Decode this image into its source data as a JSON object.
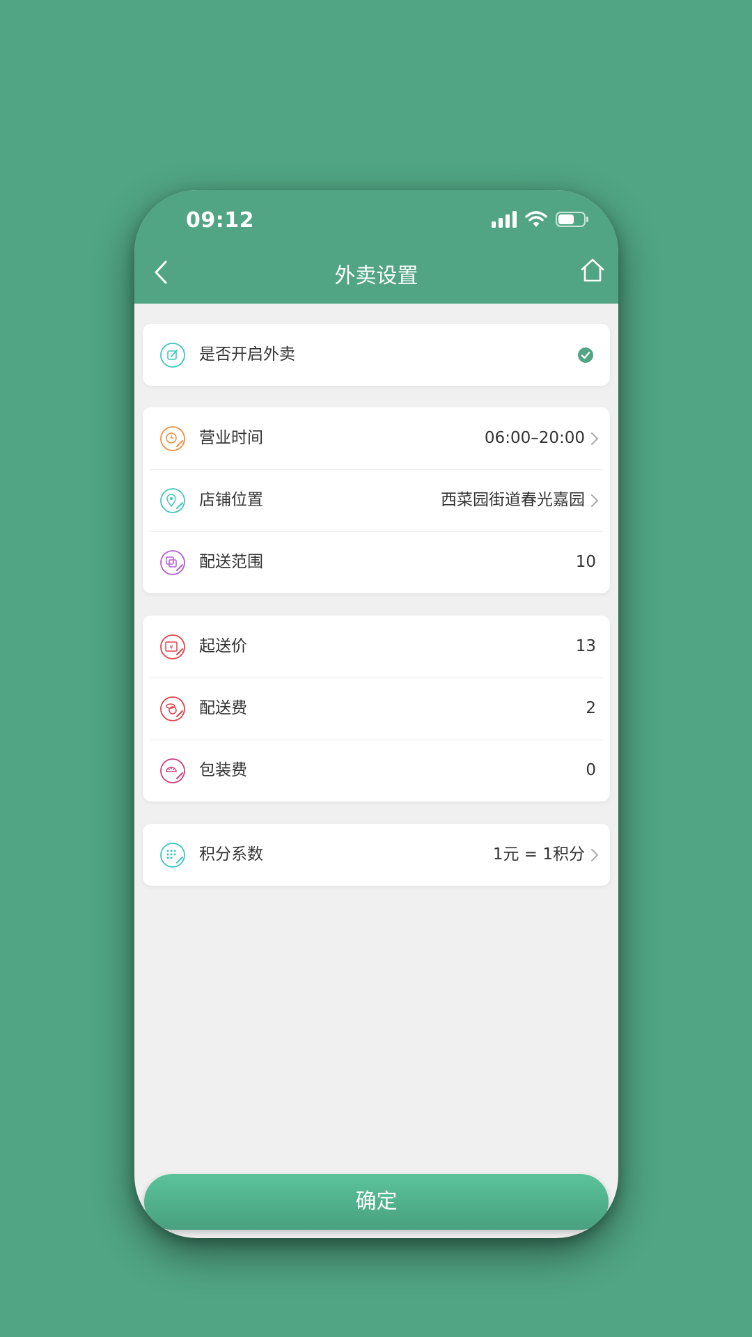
{
  "status_bar": {
    "time": "09:12"
  },
  "nav": {
    "title": "外卖设置"
  },
  "colors": {
    "brand": "#51a584",
    "check": "#51a584",
    "icon_teal": "#3ec6c0",
    "icon_orange": "#f28c3c",
    "icon_purple": "#b65cd6",
    "icon_red": "#e2414a",
    "icon_pink": "#d03c7c"
  },
  "toggle_card": {
    "label": "是否开启外卖",
    "icon": "edit-icon",
    "checked": true
  },
  "store_card": {
    "rows": [
      {
        "label": "营业时间",
        "value": "06:00–20:00",
        "icon": "clock-edit-icon"
      },
      {
        "label": "店铺位置",
        "value": "西菜园街道春光嘉园",
        "icon": "location-edit-icon"
      },
      {
        "label": "配送范围",
        "value": "10",
        "icon": "range-edit-icon"
      }
    ]
  },
  "fee_card": {
    "rows": [
      {
        "label": "起送价",
        "value": "13",
        "icon": "price-ticket-edit-icon"
      },
      {
        "label": "配送费",
        "value": "2",
        "icon": "delivery-fee-edit-icon"
      },
      {
        "label": "包装费",
        "value": "0",
        "icon": "package-fee-edit-icon"
      }
    ]
  },
  "points_card": {
    "label": "积分系数",
    "value": "1元 = 1积分",
    "icon": "points-edit-icon"
  },
  "confirm_button": {
    "label": "确定"
  }
}
